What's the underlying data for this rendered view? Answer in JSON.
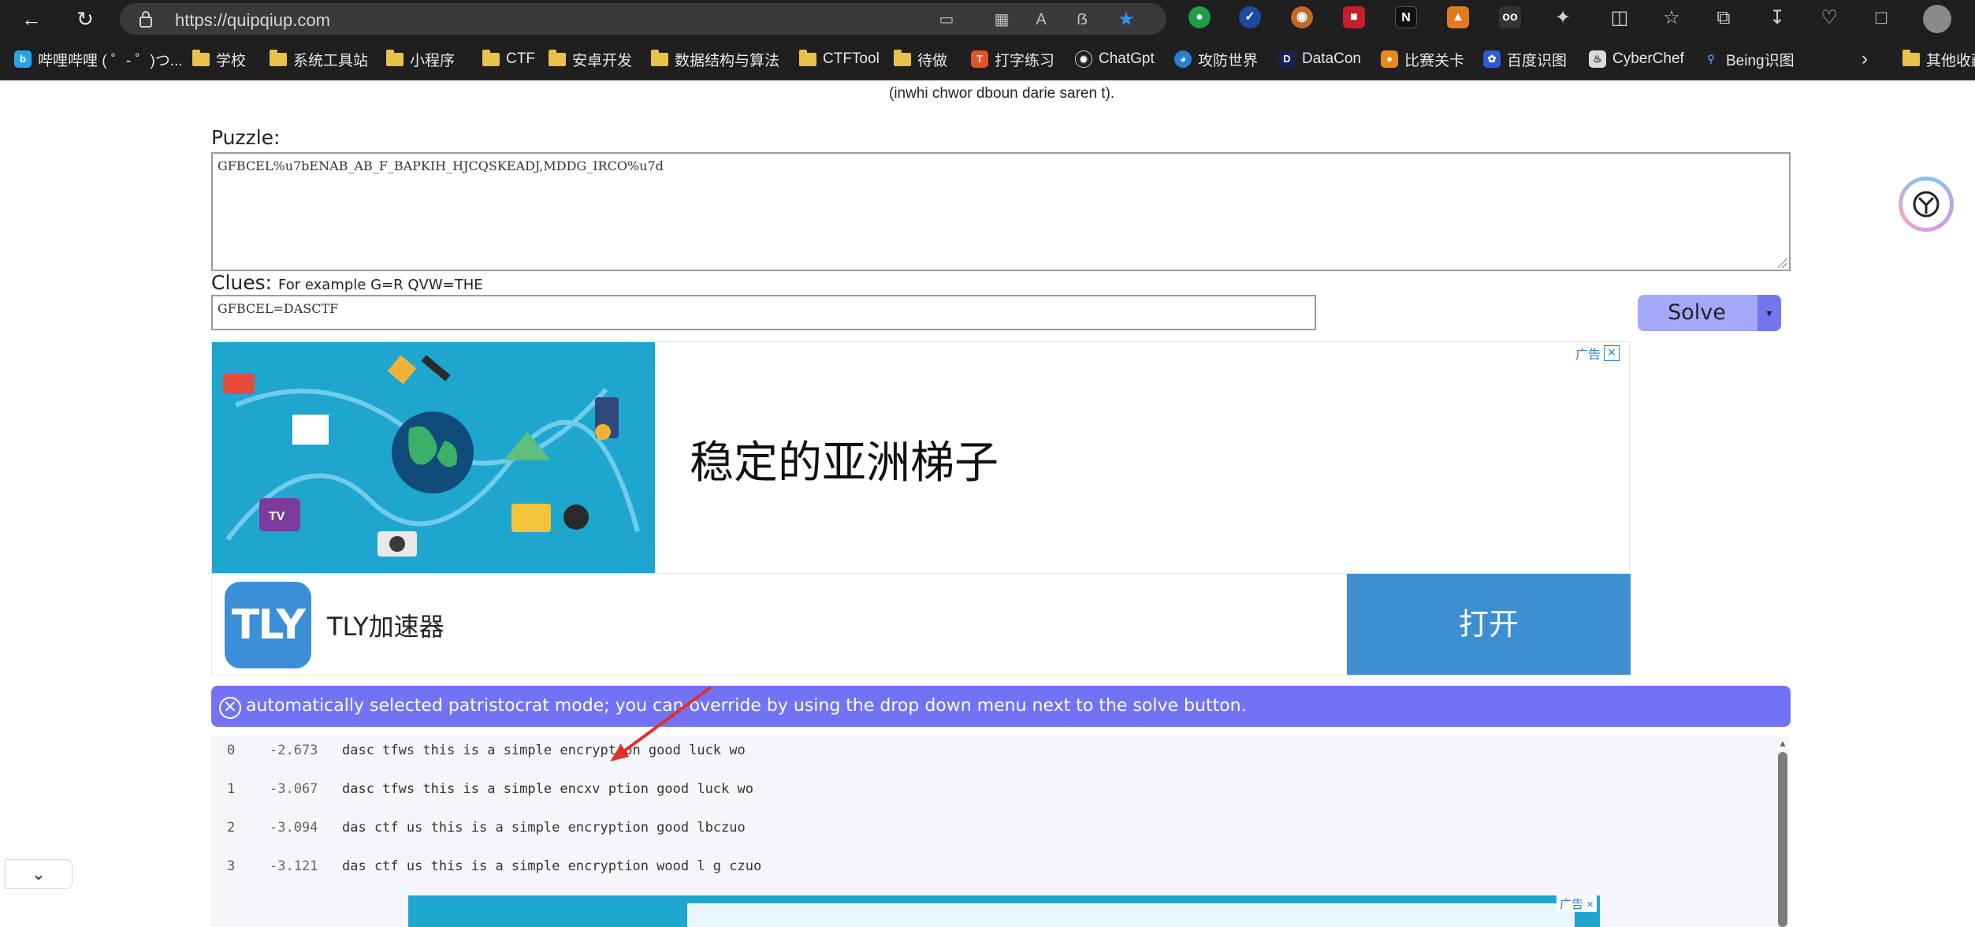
{
  "browser": {
    "url": "https://quipqiup.com",
    "bookmarks": [
      {
        "label": "哔哩哔哩 ( ゜- ゜)つ...",
        "icon": "bilibili-icon",
        "type": "site"
      },
      {
        "label": "学校",
        "icon": "folder-icon",
        "type": "folder"
      },
      {
        "label": "系统工具站",
        "icon": "folder-icon",
        "type": "folder"
      },
      {
        "label": "小程序",
        "icon": "folder-icon",
        "type": "folder"
      },
      {
        "label": "CTF",
        "icon": "folder-icon",
        "type": "folder"
      },
      {
        "label": "安卓开发",
        "icon": "folder-icon",
        "type": "folder"
      },
      {
        "label": "数据结构与算法",
        "icon": "folder-icon",
        "type": "folder"
      },
      {
        "label": "CTFTool",
        "icon": "folder-icon",
        "type": "folder"
      },
      {
        "label": "待做",
        "icon": "folder-icon",
        "type": "folder"
      },
      {
        "label": "打字练习",
        "icon": "typing-icon",
        "type": "site"
      },
      {
        "label": "ChatGpt",
        "icon": "chatgpt-icon",
        "type": "site"
      },
      {
        "label": "攻防世界",
        "icon": "globe-icon",
        "type": "site"
      },
      {
        "label": "DataCon",
        "icon": "datacon-icon",
        "type": "site"
      },
      {
        "label": "比赛关卡",
        "icon": "contest-icon",
        "type": "site"
      },
      {
        "label": "百度识图",
        "icon": "baidu-icon",
        "type": "site"
      },
      {
        "label": "CyberChef",
        "icon": "chef-icon",
        "type": "site"
      },
      {
        "label": "Being识图",
        "icon": "search-icon",
        "type": "site"
      }
    ],
    "other_bookmarks": "其他收藏"
  },
  "page": {
    "intro_tail": "(inwhi chwor dboun darie saren t).",
    "puzzle_label": "Puzzle:",
    "puzzle_value": "GFBCEL%u7bENAB_AB_F_BAPKIH_HJCQSKEADJ,MDDG_IRCO%u7d",
    "clues_label": "Clues:",
    "clues_hint": "For example G=R QVW=THE",
    "clues_value": "GFBCEL=DASCTF",
    "solve_label": "Solve",
    "solve_dropdown": "▾"
  },
  "ad": {
    "flag": "广告",
    "title": "稳定的亚洲梯子",
    "brand_logo": "TLY",
    "brand_name": "TLY加速器",
    "open_label": "打开"
  },
  "notice": {
    "text": "automatically selected patristocrat mode; you can override by using the drop down menu next to the solve button."
  },
  "results": [
    {
      "index": "0",
      "score": "-2.673",
      "text": "dasc tfws this is a simple encryption good luck wo"
    },
    {
      "index": "1",
      "score": "-3.067",
      "text": "dasc tfws this is a simple encxv ption good luck wo"
    },
    {
      "index": "2",
      "score": "-3.094",
      "text": "das ctf us this is a simple encryption good lbczuo"
    },
    {
      "index": "3",
      "score": "-3.121",
      "text": "das ctf us this is a simple encryption wood l g czuo"
    }
  ],
  "colors": {
    "accent": "#7272f5",
    "solve_button": "#a4a8f8",
    "ad_blue": "#1fa6cf",
    "open_button": "#3d8fd1",
    "annotation_arrow": "#e0302a"
  }
}
